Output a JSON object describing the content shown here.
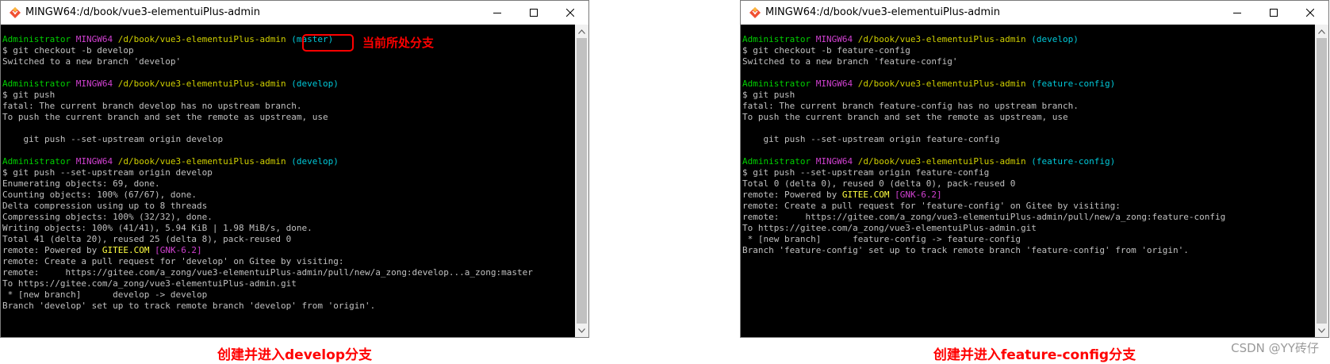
{
  "colors": {
    "default": "#c0c0c0",
    "user": "#00d000",
    "msys": "#d040d0",
    "path": "#d0d000",
    "branch": "#00c8d8",
    "gitee": "#ffff40",
    "annotation": "#ff0000",
    "terminal_bg": "#000000"
  },
  "windows": [
    {
      "id": "left",
      "title": "MINGW64:/d/book/vue3-elementuiPlus-admin",
      "lines": [
        [
          [
            "Administrator",
            "user"
          ],
          [
            " ",
            "default"
          ],
          [
            "MINGW64",
            "msys"
          ],
          [
            " ",
            "default"
          ],
          [
            "/d/book/vue3-elementuiPlus-admin",
            "path"
          ],
          [
            " ",
            "default"
          ],
          [
            "(master)",
            "branch"
          ]
        ],
        [
          [
            "$ git checkout -b develop",
            "default"
          ]
        ],
        [
          [
            "Switched to a new branch 'develop'",
            "default"
          ]
        ],
        [],
        [
          [
            "Administrator",
            "user"
          ],
          [
            " ",
            "default"
          ],
          [
            "MINGW64",
            "msys"
          ],
          [
            " ",
            "default"
          ],
          [
            "/d/book/vue3-elementuiPlus-admin",
            "path"
          ],
          [
            " ",
            "default"
          ],
          [
            "(develop)",
            "branch"
          ]
        ],
        [
          [
            "$ git push",
            "default"
          ]
        ],
        [
          [
            "fatal: The current branch develop has no upstream branch.",
            "default"
          ]
        ],
        [
          [
            "To push the current branch and set the remote as upstream, use",
            "default"
          ]
        ],
        [],
        [
          [
            "    git push --set-upstream origin develop",
            "default"
          ]
        ],
        [],
        [
          [
            "Administrator",
            "user"
          ],
          [
            " ",
            "default"
          ],
          [
            "MINGW64",
            "msys"
          ],
          [
            " ",
            "default"
          ],
          [
            "/d/book/vue3-elementuiPlus-admin",
            "path"
          ],
          [
            " ",
            "default"
          ],
          [
            "(develop)",
            "branch"
          ]
        ],
        [
          [
            "$ git push --set-upstream origin develop",
            "default"
          ]
        ],
        [
          [
            "Enumerating objects: 69, done.",
            "default"
          ]
        ],
        [
          [
            "Counting objects: 100% (67/67), done.",
            "default"
          ]
        ],
        [
          [
            "Delta compression using up to 8 threads",
            "default"
          ]
        ],
        [
          [
            "Compressing objects: 100% (32/32), done.",
            "default"
          ]
        ],
        [
          [
            "Writing objects: 100% (41/41), 5.94 KiB | 1.98 MiB/s, done.",
            "default"
          ]
        ],
        [
          [
            "Total 41 (delta 20), reused 25 (delta 8), pack-reused 0",
            "default"
          ]
        ],
        [
          [
            "remote: Powered by ",
            "default"
          ],
          [
            "GITEE.COM",
            "gitee"
          ],
          [
            " ",
            "default"
          ],
          [
            "[GNK-6.2]",
            "msys"
          ]
        ],
        [
          [
            "remote: Create a pull request for 'develop' on Gitee by visiting:",
            "default"
          ]
        ],
        [
          [
            "remote:     https://gitee.com/a_zong/vue3-elementuiPlus-admin/pull/new/a_zong:develop...a_zong:master",
            "default"
          ]
        ],
        [
          [
            "To https://gitee.com/a_zong/vue3-elementuiPlus-admin.git",
            "default"
          ]
        ],
        [
          [
            " * [new branch]      develop -> develop",
            "default"
          ]
        ],
        [
          [
            "Branch 'develop' set up to track remote branch 'develop' from 'origin'.",
            "default"
          ]
        ]
      ]
    },
    {
      "id": "right",
      "title": "MINGW64:/d/book/vue3-elementuiPlus-admin",
      "lines": [
        [
          [
            "Administrator",
            "user"
          ],
          [
            " ",
            "default"
          ],
          [
            "MINGW64",
            "msys"
          ],
          [
            " ",
            "default"
          ],
          [
            "/d/book/vue3-elementuiPlus-admin",
            "path"
          ],
          [
            " ",
            "default"
          ],
          [
            "(develop)",
            "branch"
          ]
        ],
        [
          [
            "$ git checkout -b feature-config",
            "default"
          ]
        ],
        [
          [
            "Switched to a new branch 'feature-config'",
            "default"
          ]
        ],
        [],
        [
          [
            "Administrator",
            "user"
          ],
          [
            " ",
            "default"
          ],
          [
            "MINGW64",
            "msys"
          ],
          [
            " ",
            "default"
          ],
          [
            "/d/book/vue3-elementuiPlus-admin",
            "path"
          ],
          [
            " ",
            "default"
          ],
          [
            "(feature-config)",
            "branch"
          ]
        ],
        [
          [
            "$ git push",
            "default"
          ]
        ],
        [
          [
            "fatal: The current branch feature-config has no upstream branch.",
            "default"
          ]
        ],
        [
          [
            "To push the current branch and set the remote as upstream, use",
            "default"
          ]
        ],
        [],
        [
          [
            "    git push --set-upstream origin feature-config",
            "default"
          ]
        ],
        [],
        [
          [
            "Administrator",
            "user"
          ],
          [
            " ",
            "default"
          ],
          [
            "MINGW64",
            "msys"
          ],
          [
            " ",
            "default"
          ],
          [
            "/d/book/vue3-elementuiPlus-admin",
            "path"
          ],
          [
            " ",
            "default"
          ],
          [
            "(feature-config)",
            "branch"
          ]
        ],
        [
          [
            "$ git push --set-upstream origin feature-config",
            "default"
          ]
        ],
        [
          [
            "Total 0 (delta 0), reused 0 (delta 0), pack-reused 0",
            "default"
          ]
        ],
        [
          [
            "remote: Powered by ",
            "default"
          ],
          [
            "GITEE.COM",
            "gitee"
          ],
          [
            " ",
            "default"
          ],
          [
            "[GNK-6.2]",
            "msys"
          ]
        ],
        [
          [
            "remote: Create a pull request for 'feature-config' on Gitee by visiting:",
            "default"
          ]
        ],
        [
          [
            "remote:     https://gitee.com/a_zong/vue3-elementuiPlus-admin/pull/new/a_zong:feature-config",
            "default"
          ]
        ],
        [
          [
            "To https://gitee.com/a_zong/vue3-elementuiPlus-admin.git",
            "default"
          ]
        ],
        [
          [
            " * [new branch]      feature-config -> feature-config",
            "default"
          ]
        ],
        [
          [
            "Branch 'feature-config' set up to track remote branch 'feature-config' from 'origin'.",
            "default"
          ]
        ]
      ]
    }
  ],
  "annotation": "当前所处分支",
  "captions": {
    "left": "创建并进入develop分支",
    "right": "创建并进入feature-config分支"
  },
  "watermark": "CSDN @YY砖仔",
  "icons": {
    "app": "git-bash-icon",
    "minimize": "minimize-icon",
    "maximize": "maximize-icon",
    "close": "close-icon",
    "scroll_up": "scroll-up-arrow-icon",
    "scroll_down": "scroll-down-arrow-icon"
  }
}
